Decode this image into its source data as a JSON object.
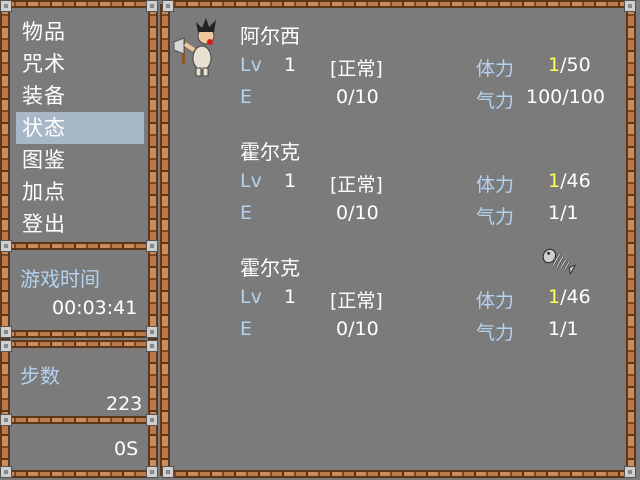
{
  "menu": {
    "items": [
      {
        "label": "物品"
      },
      {
        "label": "咒术"
      },
      {
        "label": "装备"
      },
      {
        "label": "状态",
        "selected": true
      },
      {
        "label": "图鉴"
      },
      {
        "label": "加点"
      },
      {
        "label": "登出"
      }
    ]
  },
  "game_time": {
    "label": "游戏时间",
    "value": "00:03:41"
  },
  "steps": {
    "label": "步数",
    "value": "223"
  },
  "money": {
    "value": "0S"
  },
  "labels": {
    "lv": "Lv",
    "exp": "E",
    "hp": "体力",
    "mp": "气力"
  },
  "party": [
    {
      "name": "阿尔西",
      "level": "1",
      "status": "[正常]",
      "exp": "0/10",
      "hp_current": "1",
      "hp_max": "/50",
      "mp": "100/100"
    },
    {
      "name": "霍尔克",
      "level": "1",
      "status": "[正常]",
      "exp": "0/10",
      "hp_current": "1",
      "hp_max": "/46",
      "mp": "1/1"
    },
    {
      "name": "霍尔克",
      "level": "1",
      "status": "[正常]",
      "exp": "0/10",
      "hp_current": "1",
      "hp_max": "/46",
      "mp": "1/1"
    }
  ],
  "colors": {
    "background": "#7b7b7b",
    "label_blue": "#b4d2f0",
    "hp_highlight": "#ffff60",
    "selected_bg": "#a8b8c8",
    "frame_wood": "#b9794a"
  }
}
